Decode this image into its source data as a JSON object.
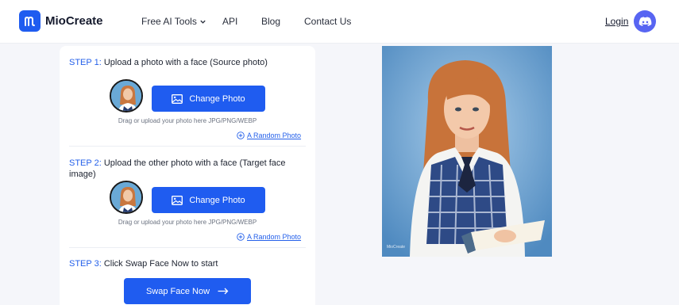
{
  "brand": {
    "name": "MioCreate",
    "logo_letter": "m",
    "color": "#1f5cf0"
  },
  "nav": {
    "items": [
      {
        "label": "Free AI Tools",
        "has_dropdown": true
      },
      {
        "label": "API"
      },
      {
        "label": "Blog"
      },
      {
        "label": "Contact Us"
      }
    ],
    "login_label": "Login",
    "discord_icon": "discord-icon"
  },
  "steps": [
    {
      "step_label": "STEP 1:",
      "title": "Upload a photo with a face (Source photo)",
      "button_label": "Change Photo",
      "hint": "Drag or upload your photo here JPG/PNG/WEBP",
      "random_label": "A Random Photo"
    },
    {
      "step_label": "STEP 2:",
      "title_line1": "Upload the other photo with a face (Target face",
      "title_line2": "image)",
      "button_label": "Change Photo",
      "hint": "Drag or upload your photo here JPG/PNG/WEBP",
      "random_label": "A Random Photo"
    },
    {
      "step_label": "STEP 3:",
      "title": "Click Swap Face Now to start",
      "button_label": "Swap Face Now"
    }
  ],
  "preview": {
    "watermark": "MioCreate"
  },
  "colors": {
    "accent": "#1f5cf0",
    "step_label": "#2460ea",
    "discord": "#5865f2"
  }
}
